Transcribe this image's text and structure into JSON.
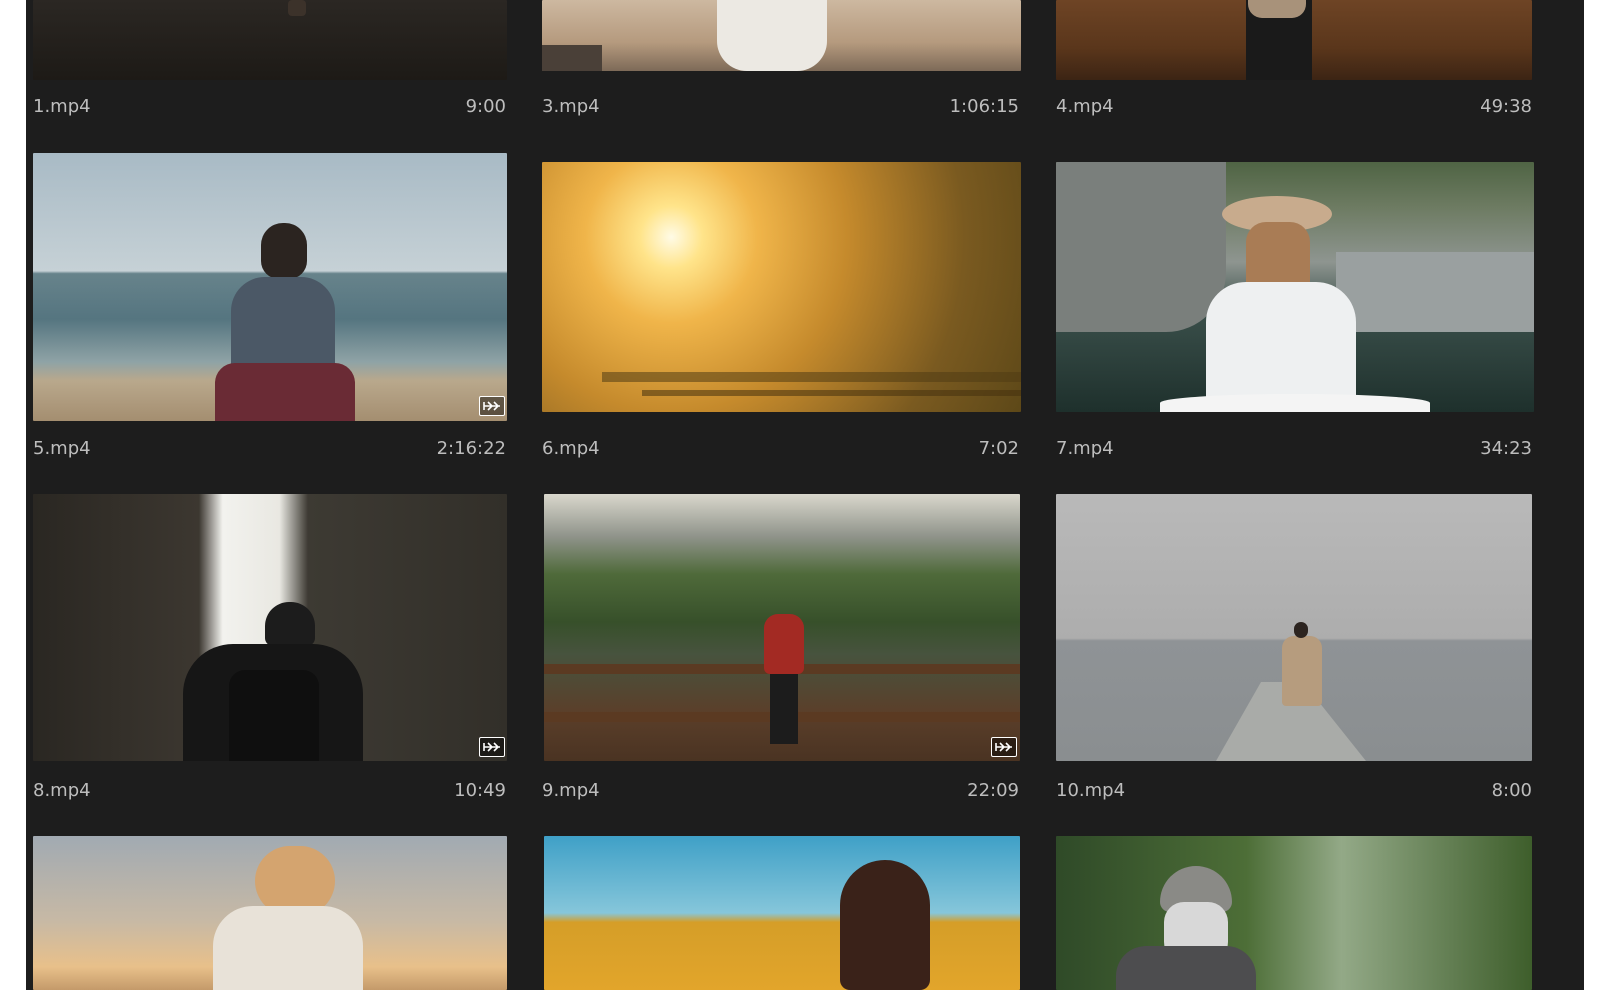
{
  "grid": {
    "items": [
      {
        "name": "1.mp4",
        "duration": "9:00",
        "has_badge": false
      },
      {
        "name": "3.mp4",
        "duration": "1:06:15",
        "has_badge": false
      },
      {
        "name": "4.mp4",
        "duration": "49:38",
        "has_badge": false
      },
      {
        "name": "5.mp4",
        "duration": "2:16:22",
        "has_badge": true
      },
      {
        "name": "6.mp4",
        "duration": "7:02",
        "has_badge": false
      },
      {
        "name": "7.mp4",
        "duration": "34:23",
        "has_badge": false
      },
      {
        "name": "8.mp4",
        "duration": "10:49",
        "has_badge": true
      },
      {
        "name": "9.mp4",
        "duration": "22:09",
        "has_badge": true
      },
      {
        "name": "10.mp4",
        "duration": "8:00",
        "has_badge": false
      }
    ]
  },
  "icons": {
    "badge": "audio-sync-icon"
  },
  "colors": {
    "panel_bg": "#1d1d1d",
    "label_text": "#bdbdbd"
  }
}
